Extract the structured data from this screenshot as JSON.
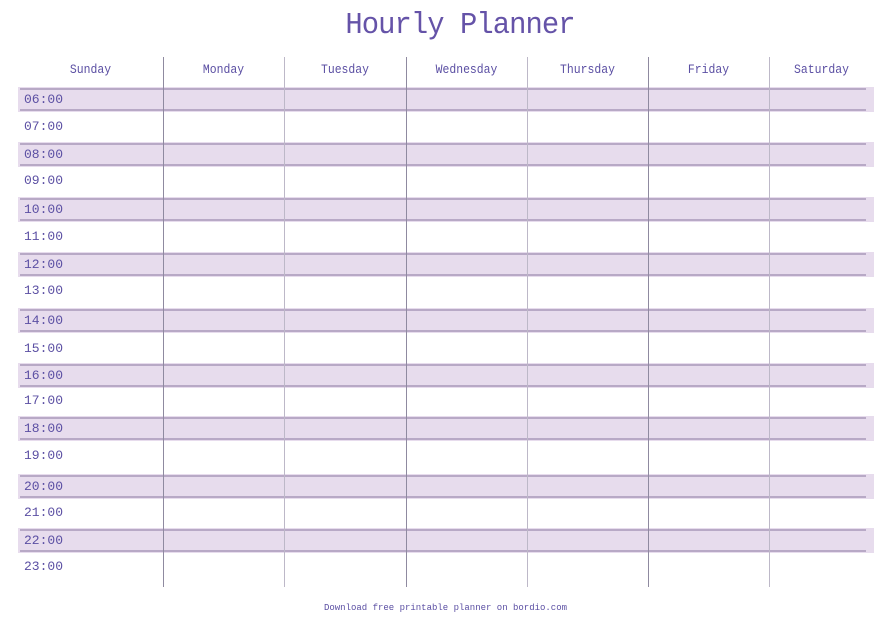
{
  "title": "Hourly Planner",
  "days": [
    "Sunday",
    "Monday",
    "Tuesday",
    "Wednesday",
    "Thursday",
    "Friday",
    "Saturday"
  ],
  "hours": [
    "06:00",
    "07:00",
    "08:00",
    "09:00",
    "10:00",
    "11:00",
    "12:00",
    "13:00",
    "14:00",
    "15:00",
    "16:00",
    "17:00",
    "18:00",
    "19:00",
    "20:00",
    "21:00",
    "22:00",
    "23:00"
  ],
  "footer": "Download free printable planner on bordio.com",
  "colors": {
    "text": "#5b4fa3",
    "band": "#e7dced",
    "band_line": "#b8a9c6",
    "grid_line": "#8f8aa0"
  }
}
